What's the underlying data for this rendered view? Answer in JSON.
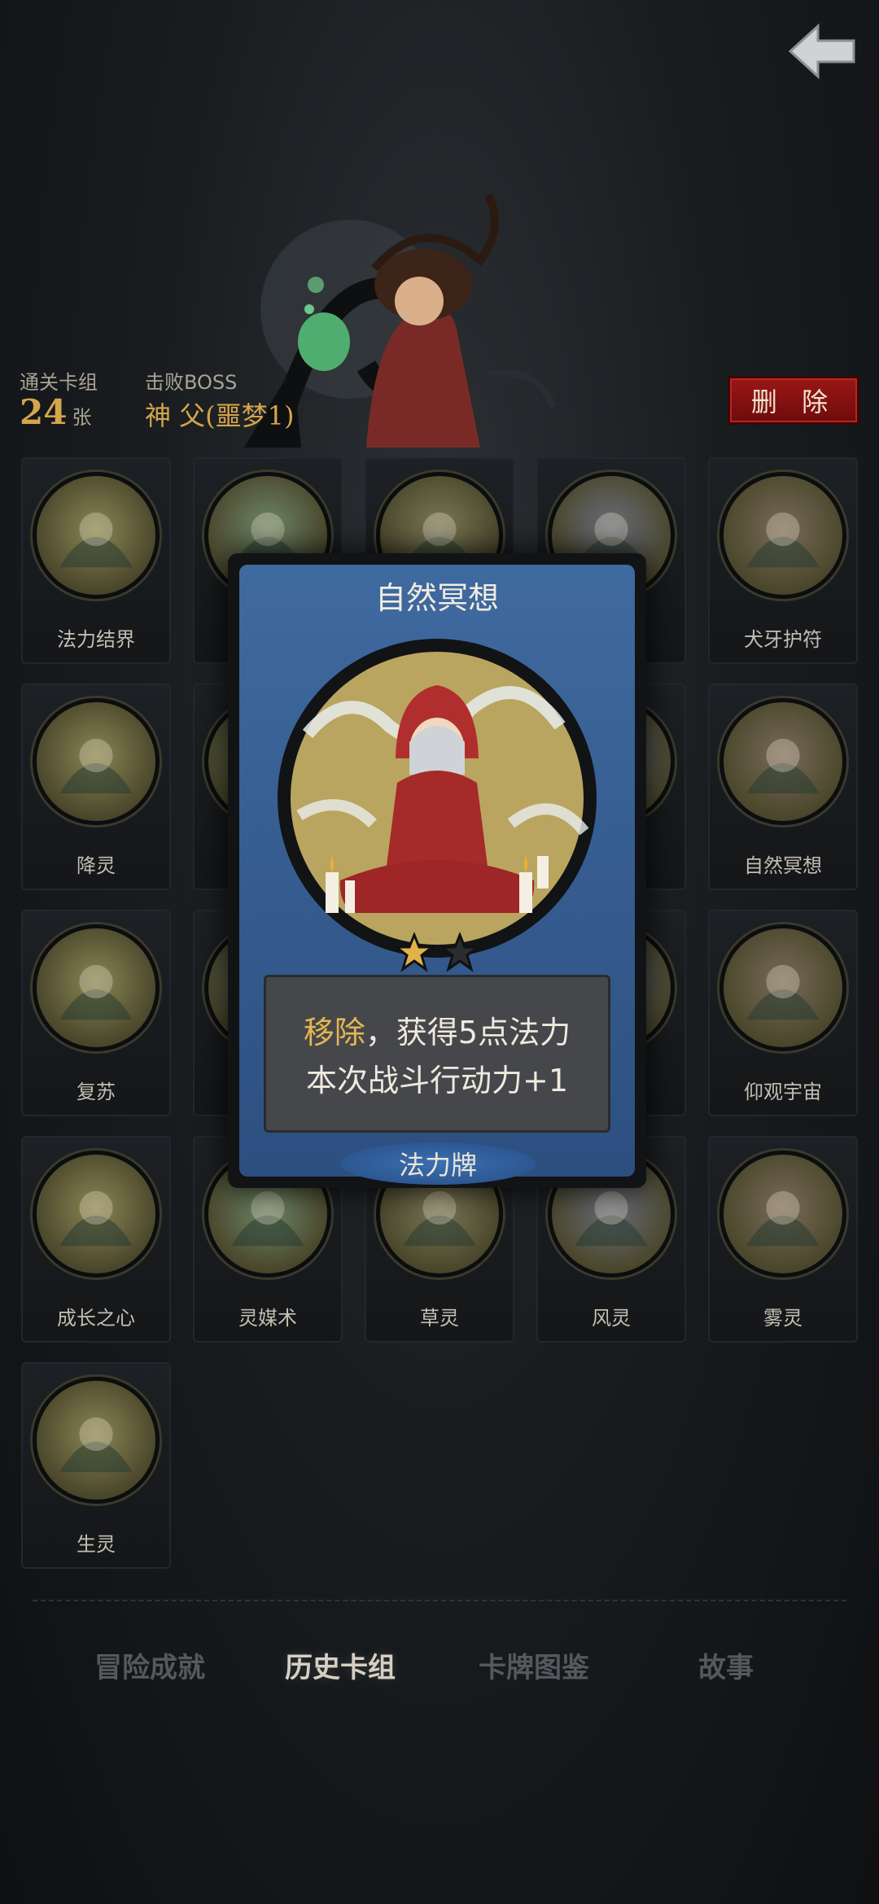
{
  "header": {
    "back_icon": "arrow-left-icon"
  },
  "stats": {
    "deck_label": "通关卡组",
    "deck_count": "24",
    "deck_unit": "张",
    "boss_label": "击败BOSS",
    "boss_name": "神 父(噩梦1)"
  },
  "actions": {
    "delete_label": "删 除"
  },
  "cards": [
    {
      "name": "法力结界"
    },
    {
      "name": ""
    },
    {
      "name": ""
    },
    {
      "name": ""
    },
    {
      "name": "犬牙护符"
    },
    {
      "name": "降灵"
    },
    {
      "name": ""
    },
    {
      "name": ""
    },
    {
      "name": ""
    },
    {
      "name": "自然冥想"
    },
    {
      "name": "复苏"
    },
    {
      "name": ""
    },
    {
      "name": ""
    },
    {
      "name": ""
    },
    {
      "name": "仰观宇宙"
    },
    {
      "name": "成长之心"
    },
    {
      "name": "灵媒术"
    },
    {
      "name": "草灵"
    },
    {
      "name": "风灵"
    },
    {
      "name": "雾灵"
    },
    {
      "name": "生灵"
    }
  ],
  "popup": {
    "title": "自然冥想",
    "stars_filled": 1,
    "stars_total": 2,
    "desc_highlight": "移除",
    "desc_rest": "，获得5点法力",
    "desc_line2": "本次战斗行动力+1",
    "type": "法力牌"
  },
  "tabs": [
    {
      "label": "冒险成就",
      "active": false
    },
    {
      "label": "历史卡组",
      "active": true
    },
    {
      "label": "卡牌图鉴",
      "active": false
    },
    {
      "label": "故事",
      "active": false
    }
  ],
  "colors": {
    "accent_gold": "#d5a54a",
    "delete_red": "#9a1616",
    "card_blue": "#3f6aa0"
  }
}
